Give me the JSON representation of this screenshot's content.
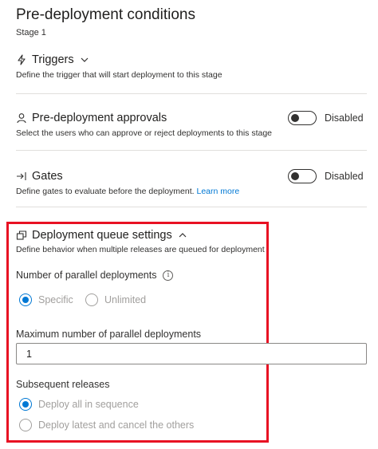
{
  "header": {
    "title": "Pre-deployment conditions",
    "stage": "Stage 1"
  },
  "triggers": {
    "label": "Triggers",
    "description": "Define the trigger that will start deployment to this stage"
  },
  "approvals": {
    "label": "Pre-deployment approvals",
    "description": "Select the users who can approve or reject deployments to this stage",
    "toggle_state": "Disabled"
  },
  "gates": {
    "label": "Gates",
    "description": "Define gates to evaluate before the deployment.",
    "learn_more": "Learn more",
    "toggle_state": "Disabled"
  },
  "queue": {
    "label": "Deployment queue settings",
    "description": "Define behavior when multiple releases are queued for deployment",
    "parallel_label": "Number of parallel deployments",
    "parallel_options": {
      "specific": "Specific",
      "unlimited": "Unlimited"
    },
    "max_label": "Maximum number of parallel deployments",
    "max_value": "1",
    "subsequent_label": "Subsequent releases",
    "subsequent_options": {
      "sequence": "Deploy all in sequence",
      "latest": "Deploy latest and cancel the others"
    }
  },
  "colors": {
    "accent": "#0078d4",
    "highlight": "#e81123"
  },
  "icons": {
    "triggers": "lightning-icon",
    "approvals": "person-icon",
    "gates": "arrow-into-bar-icon",
    "queue": "stacked-windows-icon",
    "info": "info-icon"
  }
}
